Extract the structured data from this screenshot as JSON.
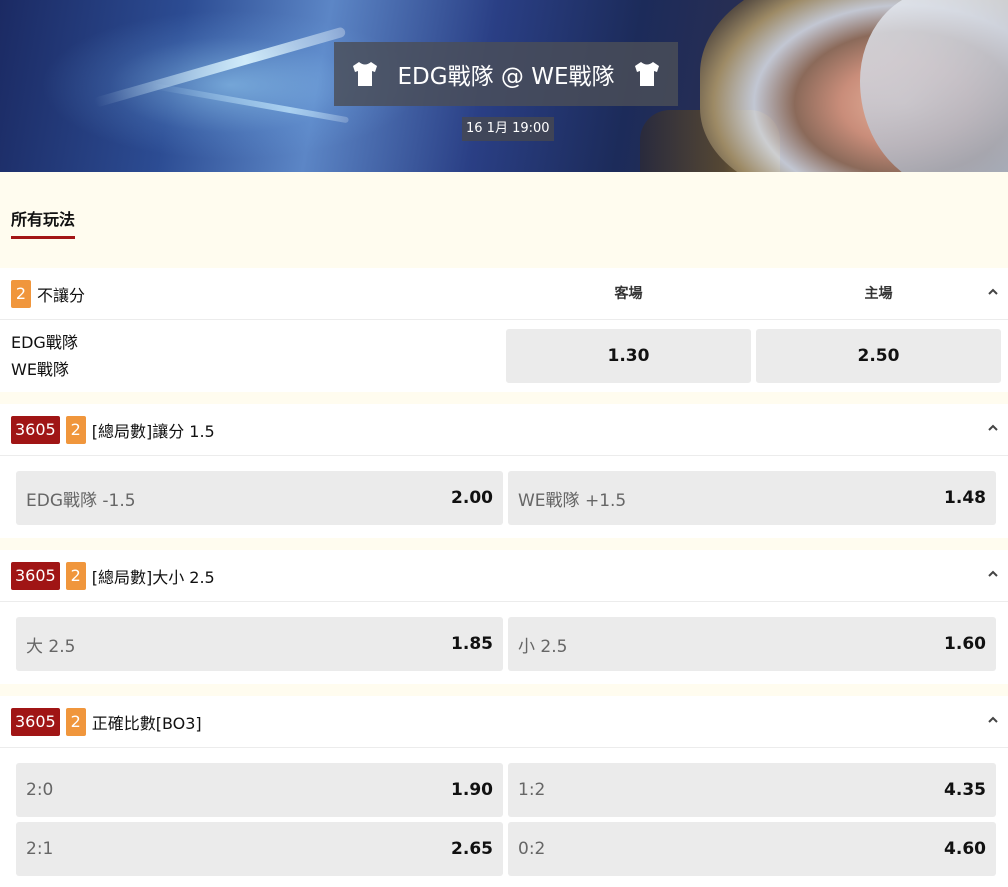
{
  "banner": {
    "home_team": "EDG戰隊",
    "away_team": "WE戰隊",
    "title": "EDG戰隊 @ WE戰隊",
    "datetime": "16 1月 19:00"
  },
  "tabs": [
    {
      "label": "所有玩法",
      "active": true
    }
  ],
  "colors": {
    "accent_red": "#a01515",
    "badge_orange": "#f0963c",
    "page_bg": "#fffcef",
    "button_bg": "#ebebeb"
  },
  "markets": [
    {
      "count": "2",
      "title": "不讓分",
      "col_away": "客場",
      "col_home": "主場",
      "teams": [
        "EDG戰隊",
        "WE戰隊"
      ],
      "odds": [
        "1.30",
        "2.50"
      ]
    },
    {
      "id": "3605",
      "count": "2",
      "title": "[總局數]讓分 1.5",
      "options": [
        {
          "label": "EDG戰隊 -1.5",
          "odds": "2.00"
        },
        {
          "label": "WE戰隊 +1.5",
          "odds": "1.48"
        }
      ]
    },
    {
      "id": "3605",
      "count": "2",
      "title": "[總局數]大小 2.5",
      "options": [
        {
          "label": "大 2.5",
          "odds": "1.85"
        },
        {
          "label": "小 2.5",
          "odds": "1.60"
        }
      ]
    },
    {
      "id": "3605",
      "count": "2",
      "title": "正確比數[BO3]",
      "options": [
        {
          "label": "2:0",
          "odds": "1.90"
        },
        {
          "label": "1:2",
          "odds": "4.35"
        },
        {
          "label": "2:1",
          "odds": "2.65"
        },
        {
          "label": "0:2",
          "odds": "4.60"
        }
      ]
    }
  ]
}
